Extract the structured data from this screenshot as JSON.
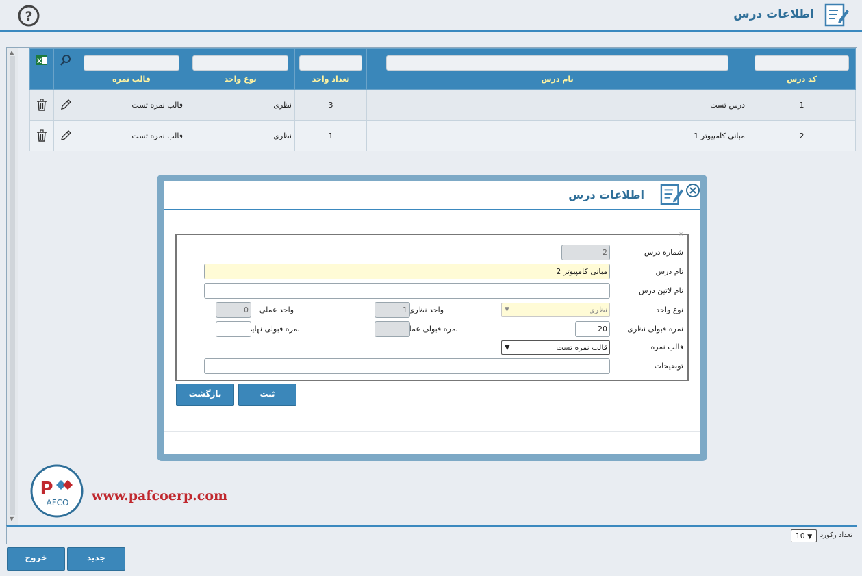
{
  "header": {
    "title": "اطلاعات درس"
  },
  "grid": {
    "columns": [
      "کد درس",
      "نام درس",
      "تعداد واحد",
      "نوع واحد",
      "قالب نمره"
    ],
    "rows": [
      {
        "code": "1",
        "name": "درس تست",
        "units": "3",
        "type": "نظری",
        "template": "قالب نمره تست"
      },
      {
        "code": "2",
        "name": "مبانی کامپیوتر 1",
        "units": "1",
        "type": "نظری",
        "template": "قالب نمره تست"
      }
    ],
    "icons": {
      "search": "search-icon",
      "excel": "excel-icon",
      "edit": "pencil-icon",
      "delete": "trash-icon"
    }
  },
  "modal": {
    "title": "اطلاعات درس",
    "fields": {
      "lesson_number": {
        "label": "شماره درس",
        "value": "2"
      },
      "lesson_name": {
        "label": "نام درس",
        "value": "مبانی کامپیوتر 2"
      },
      "latin_name": {
        "label": "نام لاتین درس",
        "value": ""
      },
      "unit_type": {
        "label": "نوع واحد",
        "value": "نظری"
      },
      "theory_units": {
        "label": "واحد نظری",
        "value": "1"
      },
      "practical_units": {
        "label": "واحد عملی",
        "value": "0"
      },
      "theory_pass": {
        "label": "نمره قبولی نظری",
        "value": "20"
      },
      "practical_pass": {
        "label": "نمره قبولی عملی",
        "value": ""
      },
      "final_pass": {
        "label": "نمره قبولی نهایی",
        "value": ""
      },
      "grade_template": {
        "label": "قالب نمره",
        "value": "قالب نمره تست"
      },
      "description": {
        "label": "توضیحات",
        "value": ""
      }
    },
    "buttons": {
      "submit": "ثبت",
      "back": "بازگشت"
    }
  },
  "logo": {
    "letters_top": "P",
    "letters_bottom": "AFCO"
  },
  "site": "www.pafcoerp.com",
  "pager": {
    "label": "تعداد رکورد :",
    "value": "10"
  },
  "footer_buttons": {
    "new": "جدید",
    "exit": "خروج"
  },
  "colors": {
    "accent": "#3b87ba",
    "header_text": "#fff3a0",
    "title": "#2f6f99",
    "brand_red": "#c0282e"
  }
}
